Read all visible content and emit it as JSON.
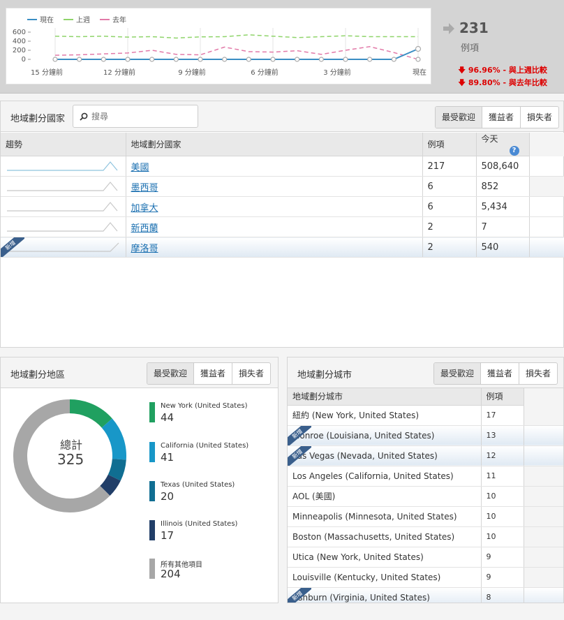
{
  "trend_chart": {
    "legend": [
      {
        "label": "現在",
        "color": "#3a8ec4"
      },
      {
        "label": "上週",
        "color": "#8fd46a"
      },
      {
        "label": "去年",
        "color": "#e27aa8"
      }
    ],
    "y_ticks": [
      "600",
      "400",
      "200",
      "0"
    ],
    "x_ticks": [
      "15 分鐘前",
      "12 分鐘前",
      "9 分鐘前",
      "6 分鐘前",
      "3 分鐘前",
      "現在"
    ]
  },
  "chart_data": {
    "type": "line",
    "x": [
      15,
      14,
      13,
      12,
      11,
      10,
      9,
      8,
      7,
      6,
      5,
      4,
      3,
      2,
      1,
      0
    ],
    "ylim": [
      0,
      600
    ],
    "series": [
      {
        "name": "現在",
        "values": [
          0,
          0,
          0,
          0,
          0,
          0,
          0,
          0,
          0,
          0,
          0,
          0,
          0,
          0,
          0,
          231
        ]
      },
      {
        "name": "上週",
        "values": [
          510,
          500,
          510,
          490,
          500,
          470,
          495,
          500,
          540,
          510,
          480,
          500,
          520,
          500,
          500,
          500
        ]
      },
      {
        "name": "去年",
        "values": [
          90,
          100,
          120,
          140,
          200,
          110,
          100,
          270,
          170,
          160,
          190,
          110,
          200,
          280,
          150,
          0
        ]
      }
    ]
  },
  "summary": {
    "count": "231",
    "unit": "例項",
    "week_compare": "96.96% - 與上週比較",
    "year_compare": "89.80% - 與去年比較"
  },
  "country_panel": {
    "title": "地域劃分國家",
    "search_placeholder": "搜尋",
    "tabs": [
      "最受歡迎",
      "獲益者",
      "損失者"
    ],
    "columns": [
      "趨勢",
      "地域劃分國家",
      "例項",
      "今天"
    ],
    "rows": [
      {
        "name": "美國",
        "count": "217",
        "today": "508,640",
        "new": false
      },
      {
        "name": "墨西哥",
        "count": "6",
        "today": "852",
        "new": false
      },
      {
        "name": "加拿大",
        "count": "6",
        "today": "5,434",
        "new": false
      },
      {
        "name": "新西蘭",
        "count": "2",
        "today": "7",
        "new": false
      },
      {
        "name": "摩洛哥",
        "count": "2",
        "today": "540",
        "new": true
      }
    ],
    "new_label": "新增"
  },
  "region_panel": {
    "title": "地域劃分地區",
    "tabs": [
      "最受歡迎",
      "獲益者",
      "損失者"
    ],
    "total_label": "總計",
    "total_value": "325",
    "items": [
      {
        "name": "New York (United States)",
        "value": 44,
        "color": "#20a060"
      },
      {
        "name": "California (United States)",
        "value": 41,
        "color": "#1897c8"
      },
      {
        "name": "Texas (United States)",
        "value": 20,
        "color": "#106e92"
      },
      {
        "name": "Illinois (United States)",
        "value": 17,
        "color": "#213e68"
      },
      {
        "name": "所有其他項目",
        "value": 204,
        "color": "#a7a7a7"
      }
    ]
  },
  "city_panel": {
    "title": "地域劃分城市",
    "tabs": [
      "最受歡迎",
      "獲益者",
      "損失者"
    ],
    "columns": [
      "地域劃分城市",
      "例項"
    ],
    "rows": [
      {
        "name": "紐約 (New York, United States)",
        "count": "17",
        "new": false
      },
      {
        "name": "Monroe (Louisiana, United States)",
        "count": "13",
        "new": true
      },
      {
        "name": "Las Vegas (Nevada, United States)",
        "count": "12",
        "new": true
      },
      {
        "name": "Los Angeles (California, United States)",
        "count": "11",
        "new": false
      },
      {
        "name": "AOL (美國)",
        "count": "10",
        "new": false
      },
      {
        "name": "Minneapolis (Minnesota, United States)",
        "count": "10",
        "new": false
      },
      {
        "name": "Boston (Massachusetts, United States)",
        "count": "10",
        "new": false
      },
      {
        "name": "Utica (New York, United States)",
        "count": "9",
        "new": false
      },
      {
        "name": "Louisville (Kentucky, United States)",
        "count": "9",
        "new": false
      },
      {
        "name": "Ashburn (Virginia, United States)",
        "count": "8",
        "new": true
      }
    ],
    "new_label": "新增"
  }
}
